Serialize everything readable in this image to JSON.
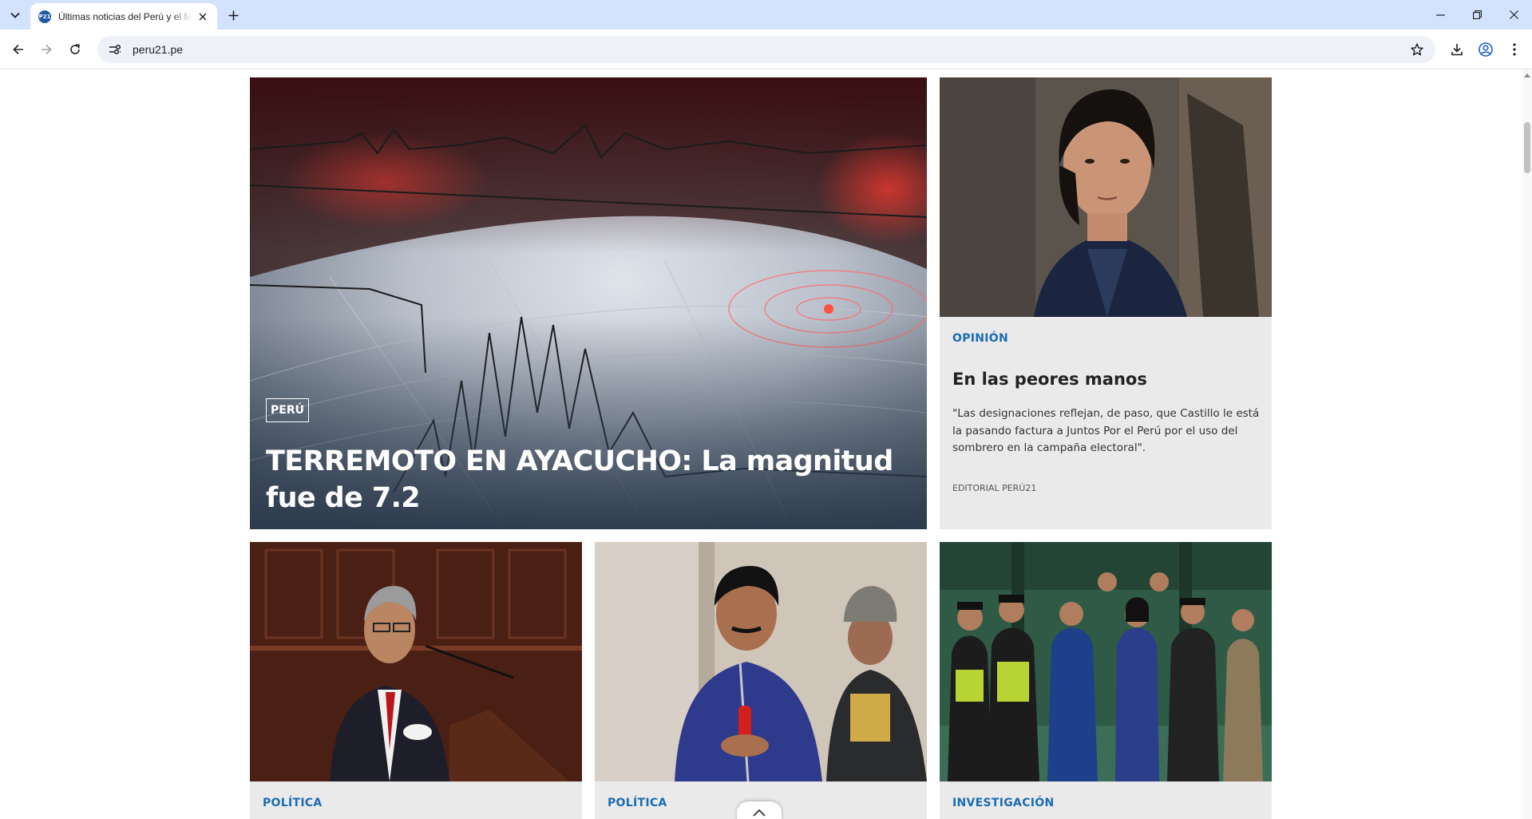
{
  "browser": {
    "tab_title": "Últimas noticias del Perú y el Mundo",
    "favicon_text": "P21",
    "url": "peru21.pe",
    "icons": [
      "tab-search-icon",
      "close-icon",
      "plus-icon",
      "minimize-icon",
      "restore-icon",
      "close-window-icon",
      "back-icon",
      "forward-icon",
      "reload-icon",
      "site-info-icon",
      "star-icon",
      "download-icon",
      "profile-icon",
      "menu-icon"
    ]
  },
  "hero": {
    "tag": "PERÚ",
    "title": "TERREMOTO EN AYACUCHO: La magnitud fue de 7.2"
  },
  "opinion": {
    "section": "OPINIÓN",
    "title": "En las peores manos",
    "excerpt": "\"Las designaciones reflejan, de paso, que Castillo le está la pasando factura a Juntos Por el Perú por el uso del sombrero en la campaña electoral\".",
    "author": "EDITORIAL PERÚ21"
  },
  "cards": [
    {
      "section": "POLÍTICA"
    },
    {
      "section": "POLÍTICA"
    },
    {
      "section": "INVESTIGACIÓN"
    }
  ],
  "colors": {
    "accent": "#1b6cb3",
    "chrome": "#d3e3fd",
    "card_bg": "#eaeaea"
  }
}
